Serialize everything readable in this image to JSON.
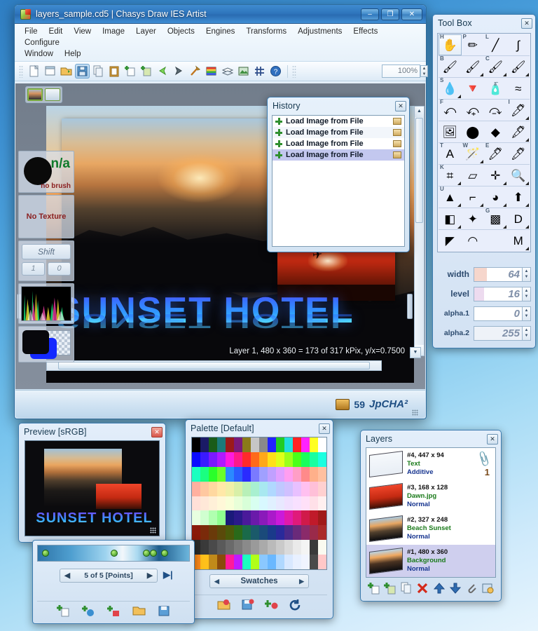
{
  "app": {
    "title": "layers_sample.cd5 | Chasys Draw IES Artist",
    "window_buttons": [
      "–",
      "❐",
      "✕"
    ]
  },
  "menubar": {
    "row1": [
      "File",
      "Edit",
      "View",
      "Image",
      "Layer",
      "Objects",
      "Engines",
      "Transforms",
      "Adjustments",
      "Effects",
      "Configure"
    ],
    "row2": [
      "Window",
      "Help"
    ]
  },
  "toolbar": {
    "zoom_value": "100%",
    "items": [
      {
        "name": "new-document-icon",
        "glyph": "🗋"
      },
      {
        "name": "new-window-icon",
        "glyph": "🗖"
      },
      {
        "name": "open-file-icon",
        "glyph": "📂"
      },
      {
        "name": "save-icon",
        "glyph": "💾"
      },
      {
        "name": "copy-icon",
        "glyph": "🗐"
      },
      {
        "name": "paste-icon",
        "glyph": "📋"
      },
      {
        "name": "add-layer-icon",
        "glyph": "🗋"
      },
      {
        "name": "import-layer-icon",
        "glyph": "🗂"
      },
      {
        "name": "undo-icon",
        "glyph": "⬅"
      },
      {
        "name": "redo-icon",
        "glyph": "➡"
      },
      {
        "name": "magic-wand-icon",
        "glyph": "🪄"
      },
      {
        "name": "palette-icon",
        "glyph": "▦"
      },
      {
        "name": "layers-icon",
        "glyph": "🗟"
      },
      {
        "name": "preview-icon",
        "glyph": "🖼"
      },
      {
        "name": "align-icon",
        "glyph": "⌗"
      },
      {
        "name": "help-icon",
        "glyph": "?"
      }
    ]
  },
  "canvas": {
    "status": "Layer 1, 480 x 360 = 173 of 317 kPix, y/x=0.7500",
    "text_layer": "SUNSET HOTEL"
  },
  "statusbar": {
    "count": "59",
    "brand": "JpCHA²"
  },
  "left_strip": {
    "brush_na": "n/a",
    "brush_label": "no brush",
    "texture_label": "No Texture",
    "shift_label": "Shift",
    "mini1": "1",
    "mini2": "0"
  },
  "history": {
    "title": "History",
    "close": "✕",
    "items": [
      {
        "label": "Load Image from File",
        "selected": false
      },
      {
        "label": "Load Image from File",
        "selected": false
      },
      {
        "label": "Load Image from File",
        "selected": false
      },
      {
        "label": "Load Image from File",
        "selected": true
      }
    ]
  },
  "toolbox": {
    "title": "Tool Box",
    "close": "✕",
    "tools": [
      {
        "name": "hand-tool",
        "key": "H",
        "glyph": "✋",
        "selected": true,
        "corner": false
      },
      {
        "name": "pencil-tool",
        "key": "P",
        "glyph": "✏",
        "selected": false,
        "corner": false
      },
      {
        "name": "line-tool",
        "key": "L",
        "glyph": "╱",
        "selected": false,
        "corner": false
      },
      {
        "name": "curve-tool",
        "key": "",
        "glyph": "∫",
        "selected": false,
        "corner": false
      },
      {
        "name": "brush-tool",
        "key": "B",
        "glyph": "🖌",
        "selected": false,
        "corner": false
      },
      {
        "name": "paintbrush-tool",
        "key": "",
        "glyph": "🖌",
        "selected": false,
        "corner": true
      },
      {
        "name": "clone-brush-tool",
        "key": "C",
        "glyph": "🖌",
        "selected": false,
        "corner": true
      },
      {
        "name": "pattern-brush-tool",
        "key": "",
        "glyph": "🖌",
        "selected": false,
        "corner": true
      },
      {
        "name": "smudge-tool",
        "key": "S",
        "glyph": "💧",
        "selected": false,
        "corner": true
      },
      {
        "name": "fill-tool",
        "key": "",
        "glyph": "🔻",
        "selected": false,
        "corner": false
      },
      {
        "name": "airbrush-tool",
        "key": "",
        "glyph": "🧴",
        "selected": false,
        "corner": false
      },
      {
        "name": "wave-tool",
        "key": "",
        "glyph": "≈",
        "selected": false,
        "corner": false
      },
      {
        "name": "flip-tool",
        "key": "F",
        "glyph": "⤺",
        "selected": false,
        "corner": false
      },
      {
        "name": "rotate-tool",
        "key": "",
        "glyph": "⤽",
        "selected": false,
        "corner": false
      },
      {
        "name": "skew-tool",
        "key": "",
        "glyph": "⤼",
        "selected": false,
        "corner": false
      },
      {
        "name": "eyedropper-tool",
        "key": "I",
        "glyph": "🖊",
        "selected": false,
        "corner": true
      },
      {
        "name": "add-image-tool",
        "key": "",
        "glyph": "🖼",
        "selected": false,
        "corner": false
      },
      {
        "name": "add-ellipse-tool",
        "key": "",
        "glyph": "⬤",
        "selected": false,
        "corner": false
      },
      {
        "name": "add-shape-tool",
        "key": "",
        "glyph": "◆",
        "selected": false,
        "corner": false
      },
      {
        "name": "pen-tool",
        "key": "",
        "glyph": "🖋",
        "selected": false,
        "corner": true
      },
      {
        "name": "text-tool",
        "key": "T",
        "glyph": "A",
        "selected": false,
        "corner": false
      },
      {
        "name": "wand-tool",
        "key": "W",
        "glyph": "🪄",
        "selected": false,
        "corner": true
      },
      {
        "name": "eraser-tool",
        "key": "E",
        "glyph": "🖊",
        "selected": false,
        "corner": false
      },
      {
        "name": "marker-tool",
        "key": "",
        "glyph": "🖊",
        "selected": false,
        "corner": false
      },
      {
        "name": "crop-tool",
        "key": "K",
        "glyph": "⌗",
        "selected": false,
        "corner": true
      },
      {
        "name": "eraser2-tool",
        "key": "",
        "glyph": "▱",
        "selected": false,
        "corner": false
      },
      {
        "name": "move-select-tool",
        "key": "",
        "glyph": "✛",
        "selected": false,
        "corner": true
      },
      {
        "name": "zoom-tool",
        "key": "",
        "glyph": "🔍",
        "selected": false,
        "corner": true
      },
      {
        "name": "shapes-tool",
        "key": "U",
        "glyph": "▲",
        "selected": false,
        "corner": true
      },
      {
        "name": "lasso-tool",
        "key": "",
        "glyph": "⌐",
        "selected": false,
        "corner": true
      },
      {
        "name": "sphere-tool",
        "key": "",
        "glyph": "◕",
        "selected": false,
        "corner": true
      },
      {
        "name": "gradient-arrow-tool",
        "key": "",
        "glyph": "⬆",
        "selected": false,
        "corner": true
      },
      {
        "name": "cube-tool",
        "key": "",
        "glyph": "◧",
        "selected": false,
        "corner": true
      },
      {
        "name": "star-tool",
        "key": "",
        "glyph": "✦",
        "selected": false,
        "corner": false
      },
      {
        "name": "gradient-tool",
        "key": "G",
        "glyph": "▩",
        "selected": false,
        "corner": true
      },
      {
        "name": "dropshadow-tool",
        "key": "",
        "glyph": "D",
        "selected": false,
        "corner": true
      },
      {
        "name": "bevel-tool",
        "key": "",
        "glyph": "◤",
        "selected": false,
        "corner": false
      },
      {
        "name": "ring-tool",
        "key": "",
        "glyph": "◠",
        "selected": false,
        "corner": false
      },
      {
        "name": "blank-tool",
        "key": "",
        "glyph": "",
        "selected": false,
        "corner": false
      },
      {
        "name": "macro-tool",
        "key": "",
        "glyph": "M",
        "selected": false,
        "corner": true
      }
    ],
    "params": [
      {
        "label": "width",
        "value": "64",
        "fill_pct": 26,
        "fill_color": "#f6d6cc"
      },
      {
        "label": "level",
        "value": "16",
        "fill_pct": 20,
        "fill_color": "#eddbef"
      },
      {
        "label": "alpha.1",
        "value": "0",
        "fill_pct": 0,
        "fill_color": "#ffffff"
      },
      {
        "label": "alpha.2",
        "value": "255",
        "fill_pct": 100,
        "fill_color": "#eef2f8"
      }
    ]
  },
  "preview": {
    "title": "Preview [sRGB]",
    "close": "✕",
    "image_text": "SUNSET HOTEL"
  },
  "palette": {
    "title": "Palette [Default]",
    "close": "✕",
    "swatch_label": "Swatches",
    "prev_arrow": "◀",
    "next_arrow": "▶",
    "tools": [
      {
        "name": "open-palette-icon",
        "glyph": "📂"
      },
      {
        "name": "save-palette-icon",
        "glyph": "💾"
      },
      {
        "name": "add-color-icon",
        "glyph": "✚"
      },
      {
        "name": "reset-palette-icon",
        "glyph": "↻"
      }
    ],
    "colors": [
      "#000000",
      "#1a1a66",
      "#1a5c1a",
      "#1a7a7a",
      "#9b1a1a",
      "#7a1a7a",
      "#8a7a1a",
      "#c6c6c6",
      "#8a8a8a",
      "#2222ff",
      "#22cc22",
      "#22dddd",
      "#ff2222",
      "#ff22ff",
      "#ffff22",
      "#ffffff",
      "#0a0aff",
      "#3a1aff",
      "#7a1aff",
      "#b01aff",
      "#ff1ae0",
      "#ff1a8a",
      "#ff2a2a",
      "#ff6a1a",
      "#ffa81a",
      "#ffe01a",
      "#e0ff1a",
      "#9bff1a",
      "#4aff1a",
      "#1aff5c",
      "#1affa0",
      "#1affe0",
      "#1affc0",
      "#1aff80",
      "#2aff2a",
      "#6aff2a",
      "#2a8aff",
      "#2a5cff",
      "#2a2aff",
      "#7a7aff",
      "#a0a0ff",
      "#c0a0ff",
      "#e0a0ff",
      "#ff9ef0",
      "#ff9ec6",
      "#ff8a8a",
      "#ffb08a",
      "#ffc0a0",
      "#ffb0a0",
      "#ffc8a0",
      "#ffd8a0",
      "#ffe8a8",
      "#f0f0a8",
      "#d8f0a8",
      "#b8f0b8",
      "#a8f0d0",
      "#a8e8f0",
      "#b0d8ff",
      "#c0c8ff",
      "#d0c0ff",
      "#e8c0ff",
      "#ffc0f0",
      "#ffc0d8",
      "#ffd0d0",
      "#ffe0d8",
      "#ffe8d8",
      "#fff0d8",
      "#fff8d8",
      "#f8ffd8",
      "#e8ffd8",
      "#d8ffd8",
      "#d8fff0",
      "#d8f8ff",
      "#e0f0ff",
      "#e8e8ff",
      "#f0e0ff",
      "#f8e0ff",
      "#ffe0f8",
      "#ffe0e8",
      "#fff0f0",
      "#e8ffe0",
      "#d0ffd0",
      "#b0ffb0",
      "#90ff90",
      "#1a1a7a",
      "#2a1a8a",
      "#4a1a9a",
      "#6a1aaa",
      "#8a1aba",
      "#aa1aca",
      "#ca1ada",
      "#e01aaa",
      "#e01a7a",
      "#d01a4a",
      "#c01a2a",
      "#a01a1a",
      "#8a1a0a",
      "#7a2a0a",
      "#6a3a0a",
      "#5a4a0a",
      "#4a5a0a",
      "#2a6a1a",
      "#1a6a4a",
      "#1a5a6a",
      "#1a4a7a",
      "#1a3a8a",
      "#2a2a9a",
      "#4a2a8a",
      "#6a2a7a",
      "#8a2a6a",
      "#9a2a4a",
      "#aa2a2a",
      "#2a2a2a",
      "#3a3a3a",
      "#4a4a4a",
      "#5a5a5a",
      "#6a6a6a",
      "#7a7a7a",
      "#8a8a8a",
      "#9a9a9a",
      "#aaaaaa",
      "#bababa",
      "#cacaca",
      "#dadada",
      "#eaeaea",
      "#f4f4f4",
      "#3a3a3a",
      "#fafaf0",
      "#ff8a1a",
      "#ffc01a",
      "#c08a1a",
      "#8a4a0a",
      "#ff1a9a",
      "#c01aff",
      "#1affc0",
      "#b0ff1a",
      "#8ac8ff",
      "#6ab8ff",
      "#b0d8ff",
      "#d8e8ff",
      "#e8f0ff",
      "#f0f4ff",
      "#4a4a4a",
      "#ffc8c8"
    ]
  },
  "layers": {
    "title": "Layers",
    "close": "✕",
    "items": [
      {
        "title": "#4, 447 x 94",
        "name": "Text",
        "mode": "Additive",
        "selected": false,
        "badge": "1",
        "clip": true
      },
      {
        "title": "#3, 168 x 128",
        "name": "Dawn.jpg",
        "mode": "Normal",
        "selected": false,
        "badge": "",
        "clip": false
      },
      {
        "title": "#2, 327 x 248",
        "name": "Beach Sunset",
        "mode": "Normal",
        "selected": false,
        "badge": "",
        "clip": false
      },
      {
        "title": "#1, 480 x 360",
        "name": "Background",
        "mode": "Normal",
        "selected": true,
        "badge": "",
        "clip": false
      }
    ],
    "tools": [
      {
        "name": "new-layer-icon",
        "glyph": "✚"
      },
      {
        "name": "duplicate-layer-icon",
        "glyph": "✚"
      },
      {
        "name": "copy-layer-icon",
        "glyph": "🗐"
      },
      {
        "name": "delete-layer-icon",
        "glyph": "✕"
      },
      {
        "name": "move-layer-up-icon",
        "glyph": "▲"
      },
      {
        "name": "move-layer-down-icon",
        "glyph": "▼"
      },
      {
        "name": "attach-layer-icon",
        "glyph": "📎"
      },
      {
        "name": "layer-properties-icon",
        "glyph": "🗒"
      }
    ]
  },
  "animation": {
    "nav_label": "5 of 5 [Points]",
    "prev_arrow": "◀",
    "next_arrow": "▶",
    "last_arrow": "▶|",
    "points": [
      6,
      104,
      150,
      160,
      176
    ],
    "tools": [
      {
        "name": "add-frame-icon",
        "glyph": "✚"
      },
      {
        "name": "add-color-point-icon",
        "glyph": "✚"
      },
      {
        "name": "add-gradient-point-icon",
        "glyph": "✚"
      },
      {
        "name": "open-gradient-icon",
        "glyph": "📂"
      },
      {
        "name": "save-gradient-icon",
        "glyph": "💾"
      }
    ]
  }
}
